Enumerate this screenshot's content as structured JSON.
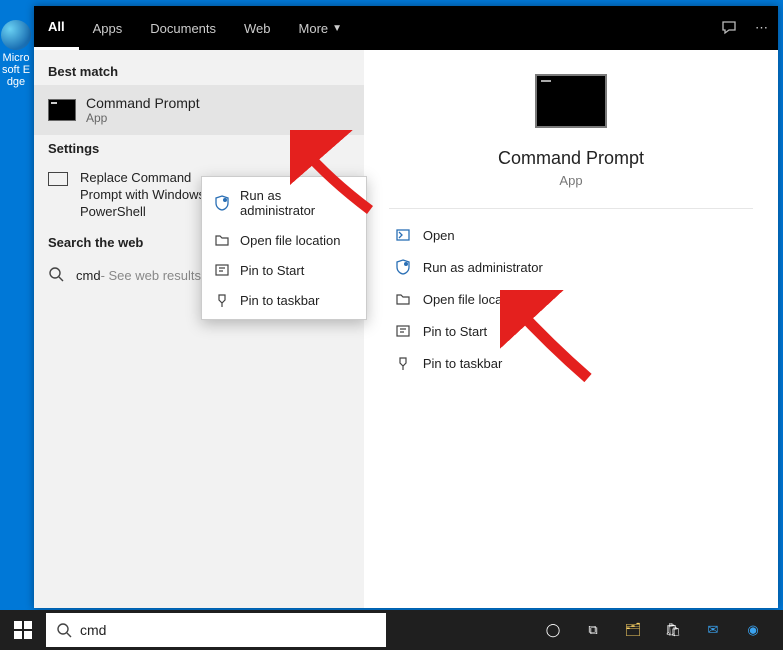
{
  "desktop": {
    "edge_label": "Microsoft Edge"
  },
  "tabs": {
    "all": "All",
    "apps": "Apps",
    "documents": "Documents",
    "web": "Web",
    "more": "More"
  },
  "left": {
    "best_match_hdr": "Best match",
    "best_item_title": "Command Prompt",
    "best_item_sub": "App",
    "settings_hdr": "Settings",
    "settings_item": "Replace Command Prompt with Windows PowerShell",
    "search_web_hdr": "Search the web",
    "web_query": "cmd",
    "web_sub": " - See web results"
  },
  "ctx": {
    "run_admin": "Run as administrator",
    "open_loc": "Open file location",
    "pin_start": "Pin to Start",
    "pin_taskbar": "Pin to taskbar"
  },
  "preview": {
    "title": "Command Prompt",
    "sub": "App",
    "open": "Open",
    "run_admin": "Run as administrator",
    "open_loc": "Open file location",
    "pin_start": "Pin to Start",
    "pin_taskbar": "Pin to taskbar"
  },
  "taskbar": {
    "search_value": "cmd"
  }
}
